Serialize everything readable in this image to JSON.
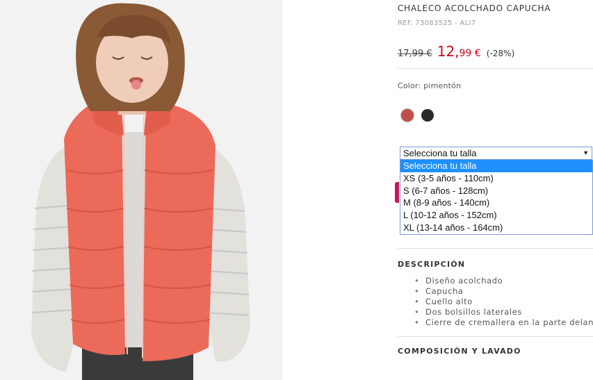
{
  "product": {
    "title": "CHALECO ACOLCHADO CAPUCHA",
    "ref": "REF. 73083525 - ALI7",
    "old_price": "17,99 €",
    "new_price_int": "12,",
    "new_price_dec": "99 €",
    "discount": "(-28%)",
    "color_label": "Color: pimentón",
    "swatches": [
      {
        "name": "pimentón",
        "color": "#c0504b"
      },
      {
        "name": "negro",
        "color": "#2a2a2a"
      }
    ]
  },
  "size_select": {
    "value": "Selecciona tu talla",
    "options": [
      "Selecciona tu talla",
      "XS (3-5 años - 110cm)",
      "S (6-7 años - 128cm)",
      "M (8-9 años - 140cm)",
      "L (10-12 años - 152cm)",
      "XL (13-14 años - 164cm)"
    ]
  },
  "description": {
    "heading": "DESCRIPCIÓN",
    "items": [
      "Diseño acolchado",
      "Capucha",
      "Cuello alto",
      "Dos bolsillos laterales",
      "Cierre de cremallera en la parte delantera"
    ]
  },
  "composition": {
    "heading": "COMPOSICIÓN Y LAVADO"
  },
  "colors": {
    "accent_red": "#d0021b",
    "vest": "#ec6a5a",
    "select_highlight": "#1e90ff"
  }
}
